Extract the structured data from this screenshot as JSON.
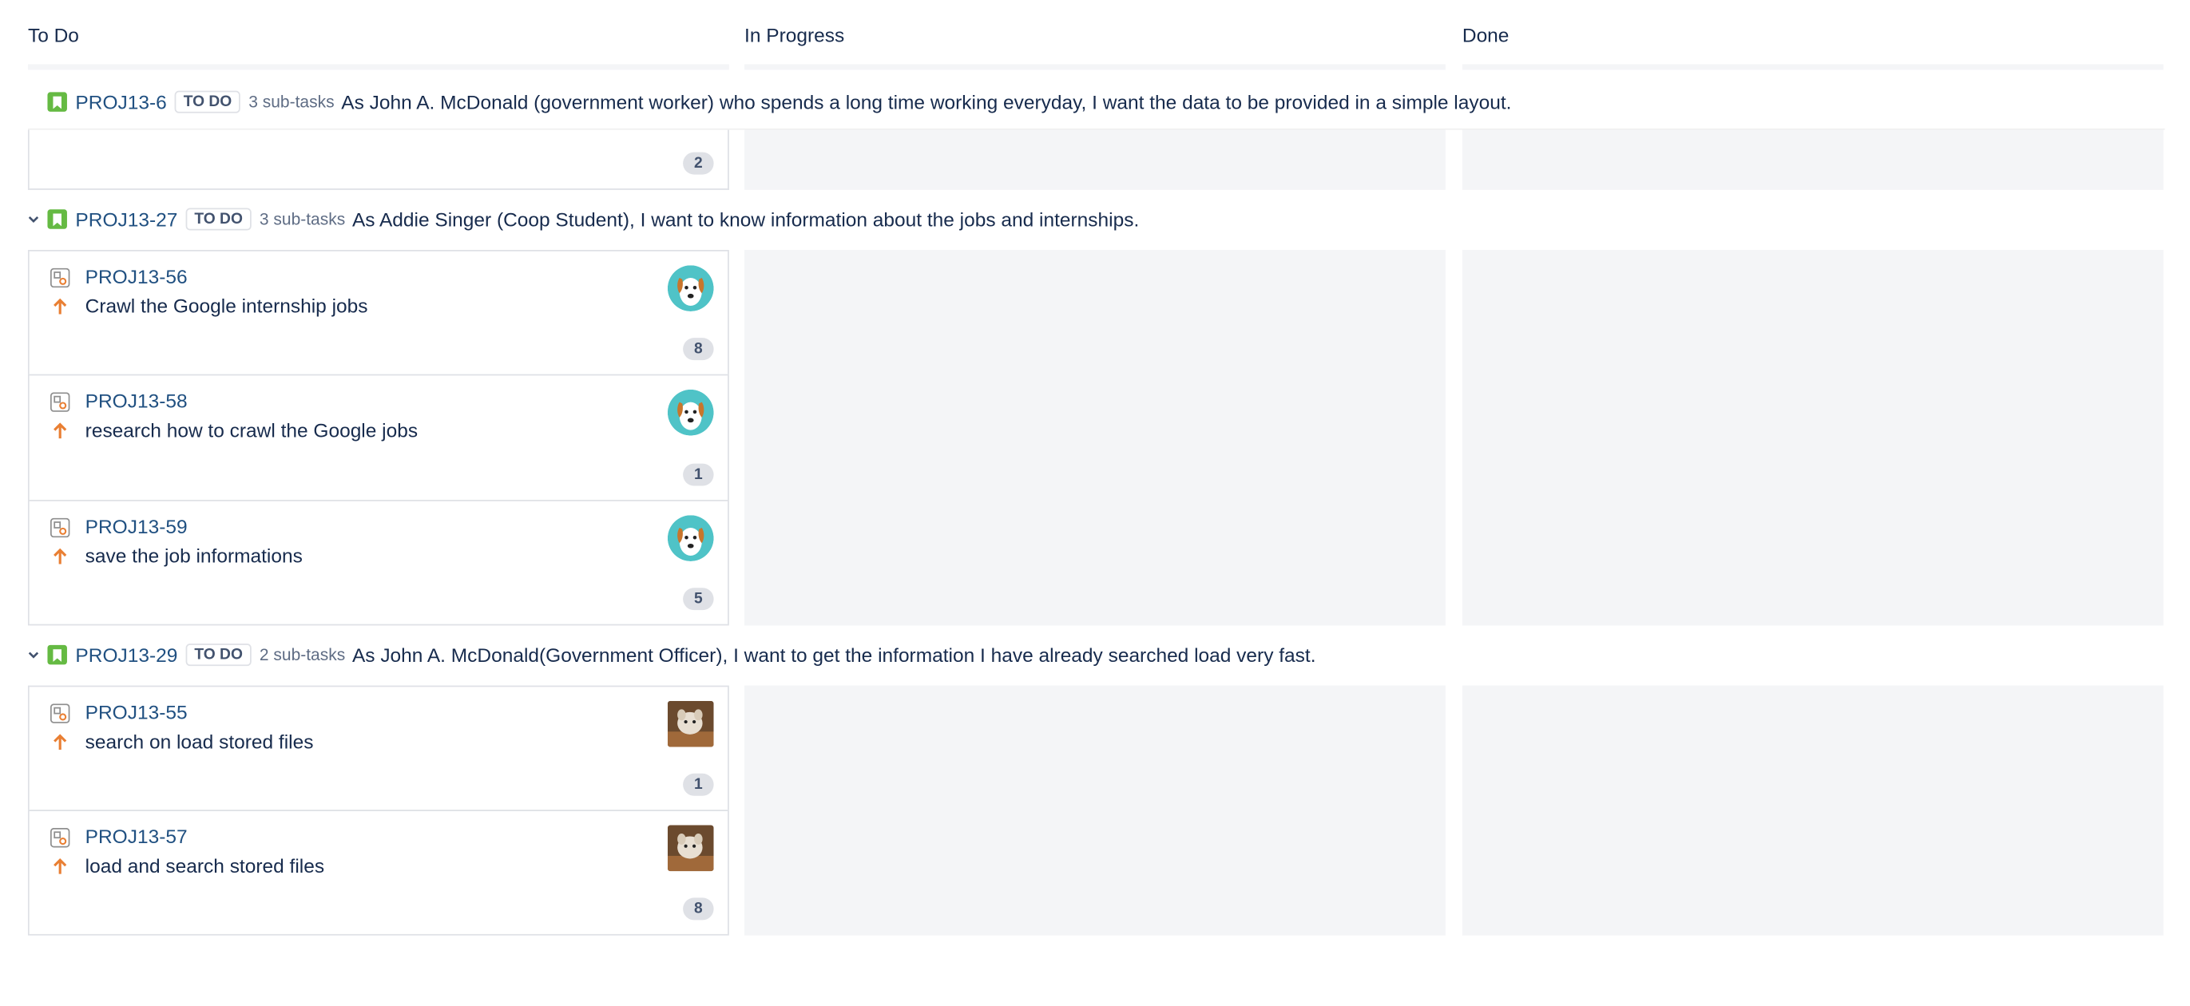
{
  "columns": [
    "To Do",
    "In Progress",
    "Done"
  ],
  "swimlanes": [
    {
      "key": "PROJ13-6",
      "status": "TO DO",
      "subtasks": "3 sub-tasks",
      "summary": "As John A. McDonald (government worker) who spends a long time working everyday, I want the data to be provided in a simple layout.",
      "cards": [
        {
          "estimate": "2"
        }
      ]
    },
    {
      "key": "PROJ13-27",
      "status": "TO DO",
      "subtasks": "3 sub-tasks",
      "summary": "As Addie Singer (Coop Student), I want to know information about the jobs and internships.",
      "cards": [
        {
          "key": "PROJ13-56",
          "summary": "Crawl the Google internship jobs",
          "estimate": "8",
          "avatar": "dog-avatar-icon"
        },
        {
          "key": "PROJ13-58",
          "summary": "research how to crawl the Google jobs",
          "estimate": "1",
          "avatar": "dog-avatar-icon"
        },
        {
          "key": "PROJ13-59",
          "summary": "save the job informations",
          "estimate": "5",
          "avatar": "dog-avatar-icon"
        }
      ]
    },
    {
      "key": "PROJ13-29",
      "status": "TO DO",
      "subtasks": "2 sub-tasks",
      "summary": "As John A. McDonald(Government Officer), I want to get the information I have already searched load very fast.",
      "cards": [
        {
          "key": "PROJ13-55",
          "summary": "search on load stored files",
          "estimate": "1",
          "avatar": "photo-avatar-icon"
        },
        {
          "key": "PROJ13-57",
          "summary": "load and search stored files",
          "estimate": "8",
          "avatar": "photo-avatar-icon"
        }
      ]
    }
  ],
  "icons": {
    "issue_type": "story-icon",
    "card_type": "subtask-icon",
    "priority": "priority-high-icon",
    "expander": "chevron-down-icon"
  },
  "colors": {
    "link": "#205081",
    "story": "#65ba43",
    "priority": "#e97f33",
    "lane_background": "#f4f5f7"
  }
}
